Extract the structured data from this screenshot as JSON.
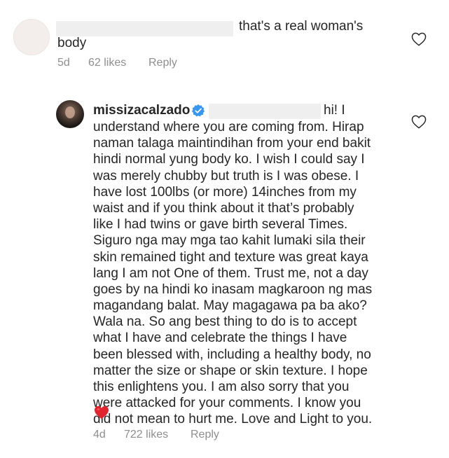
{
  "comments": [
    {
      "text_line1": "that's a real woman's",
      "text_line2": "body",
      "time": "5d",
      "likes": "62 likes",
      "reply": "Reply"
    },
    {
      "username": "missizacalzado",
      "greeting": "hi! I",
      "lines": [
        "understand where you are coming from. Hirap",
        "naman talaga maintindihan from your end bakit",
        "hindi normal yung body ko. I wish I could say I",
        "was merely chubby but truth is I was obese. I",
        "have lost 100lbs (or more) 14inches from my",
        "waist and if you think about it that’s probably",
        "like I had twins or gave birth several Times.",
        "Siguro nga may mga tao kahit lumaki sila their",
        "skin remained tight and texture was great kaya",
        "lang I am not One of them. Trust me, not a day",
        "goes by na hindi ko inasam magkaroon ng mas",
        "magandang balat. May magagawa pa ba ako?",
        "Wala na. So ang best thing to do is to accept",
        "what I have and celebrate the things I have",
        "been blessed with, including a healthy body, no",
        "matter the size or shape or skin texture. I hope",
        "this enlightens you. I am also sorry that you",
        "were attacked for your comments. I know you",
        "did not mean to hurt me. Love and Light to you."
      ],
      "emoji": "red-heart",
      "time": "4d",
      "likes": "722 likes",
      "reply": "Reply"
    }
  ],
  "colors": {
    "text": "#262626",
    "meta": "#8e8e8e",
    "verified": "#3897f0",
    "heart_red": "#e0252f",
    "redaction": "#efefef"
  }
}
